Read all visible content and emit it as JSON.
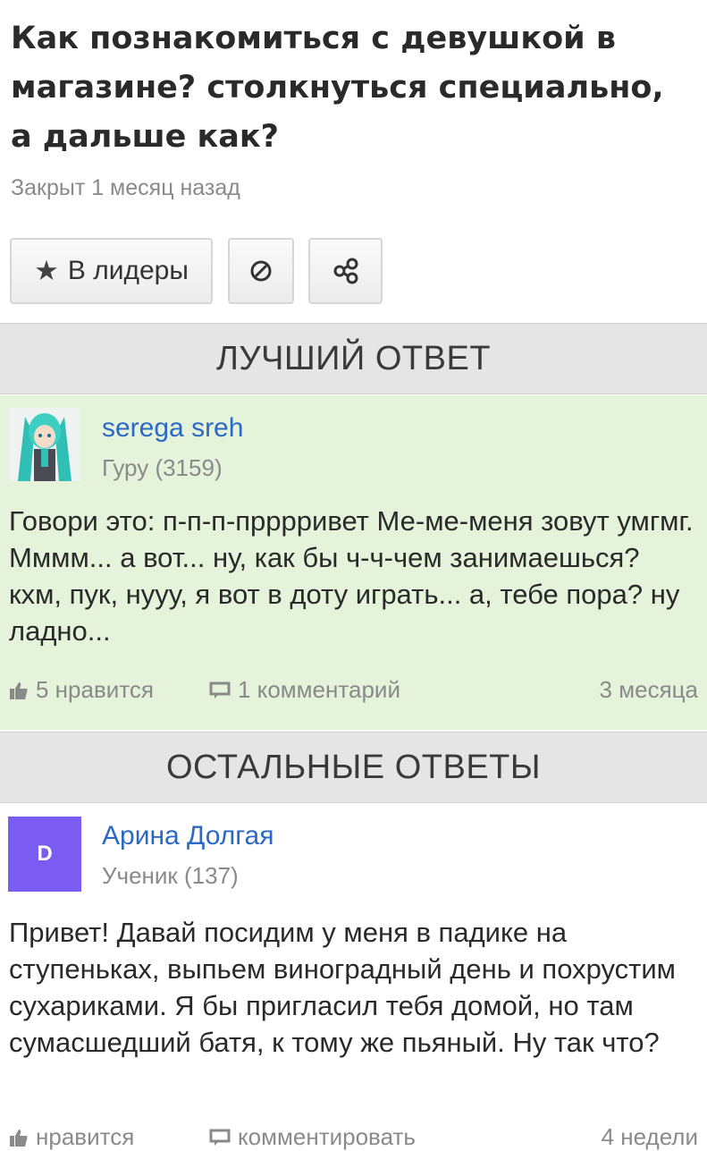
{
  "question": {
    "title": "Как познакомиться с девушкой в магазине? столкнуться специально, а дальше как?",
    "status": "Закрыт 1 месяц назад"
  },
  "actions": {
    "leaders_label": "В лидеры",
    "leaders_icon": "star-icon",
    "block_icon": "block-icon",
    "share_icon": "share-icon"
  },
  "best_answer": {
    "section_title": "ЛУЧШИЙ ОТВЕТ",
    "author": "serega sreh",
    "rank": "Гуру (3159)",
    "text": "Говори это: п-п-п-прррривет Ме-ме-меня зовут умгмг. Мммм... а вот... ну, как бы ч-ч-чем занимаешься? кхм, пук, нууу, я вот в доту играть... а, тебе пора? ну ладно...",
    "likes": "5 нравится",
    "comments": "1 комментарий",
    "time": "3 месяца",
    "background_color": "#e4f3da"
  },
  "other_answers": {
    "section_title": "ОСТАЛЬНЫЕ ОТВЕТЫ",
    "items": [
      {
        "avatar_letter": "D",
        "avatar_color": "#7b5cf2",
        "author": "Арина Долгая",
        "rank": "Ученик (137)",
        "text": "Привет! Давай посидим у меня в падике на ступеньках, выпьем виноградный день и похрустим сухариками. Я бы пригласил тебя домой, но там сумасшедший батя, к тому же пьяный. Ну так что?",
        "likes": "нравится",
        "comments": "комментировать",
        "time": "4 недели"
      }
    ]
  },
  "colors": {
    "link": "#2b69c6",
    "muted": "#8a8a8a",
    "section_header": "#e5e5e5"
  }
}
